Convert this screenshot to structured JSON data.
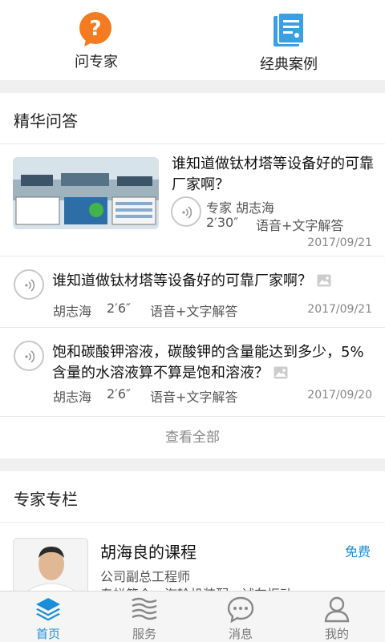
{
  "top_actions": [
    {
      "label": "问专家",
      "icon": "question-bubble-icon",
      "color": "#f47b20"
    },
    {
      "label": "经典案例",
      "icon": "document-icon",
      "color": "#3aa0e3"
    }
  ],
  "featured": {
    "title": "精华问答",
    "first": {
      "question": "谁知道做钛材塔等设备好的可靠厂家啊？",
      "expert_prefix": "专家",
      "expert": "胡志海",
      "duration": "2′30″",
      "type": "语音+文字解答",
      "date": "2017/09/21"
    },
    "items": [
      {
        "question": "谁知道做钛材塔等设备好的可靠厂家啊？",
        "expert": "胡志海",
        "duration": "2′6″",
        "type": "语音+文字解答",
        "date": "2017/09/21"
      },
      {
        "question": "饱和碳酸钾溶液，碳酸钾的含量能达到多少，5%含量的水溶液算不算是饱和溶液？",
        "expert": "胡志海",
        "duration": "2′6″",
        "type": "语音+文字解答",
        "date": "2017/09/20"
      }
    ],
    "see_all": "查看全部"
  },
  "column": {
    "title": "专家专栏",
    "course": {
      "name": "胡海良的课程",
      "price": "免费",
      "role": "公司副总工程师",
      "intro": "专栏简介：汽轮机装配，试车振动"
    }
  },
  "tabbar": {
    "active": 0,
    "accent": "#1a8fd8",
    "items": [
      {
        "label": "首页",
        "icon": "layers-icon"
      },
      {
        "label": "服务",
        "icon": "waves-icon"
      },
      {
        "label": "消息",
        "icon": "chat-bubble-icon"
      },
      {
        "label": "我的",
        "icon": "person-icon"
      }
    ]
  }
}
